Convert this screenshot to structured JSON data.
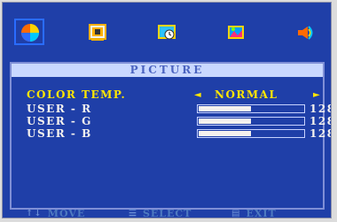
{
  "tabs": [
    {
      "name": "picture",
      "active": true
    },
    {
      "name": "image-setup",
      "active": false
    },
    {
      "name": "osd-setup",
      "active": false
    },
    {
      "name": "color",
      "active": false
    },
    {
      "name": "audio",
      "active": false
    }
  ],
  "panel": {
    "title": "PICTURE",
    "rows": [
      {
        "label": "COLOR TEMP.",
        "value": "NORMAL",
        "left_arrow": "◄",
        "right_arrow": "►"
      },
      {
        "label": "USER - R",
        "value": "128",
        "level": 0.5
      },
      {
        "label": "USER - G",
        "value": "128",
        "level": 0.5
      },
      {
        "label": "USER - B",
        "value": "128",
        "level": 0.5
      }
    ]
  },
  "footer": {
    "move_label": "MOVE",
    "select_label": "SELECT",
    "exit_label": "EXIT"
  }
}
